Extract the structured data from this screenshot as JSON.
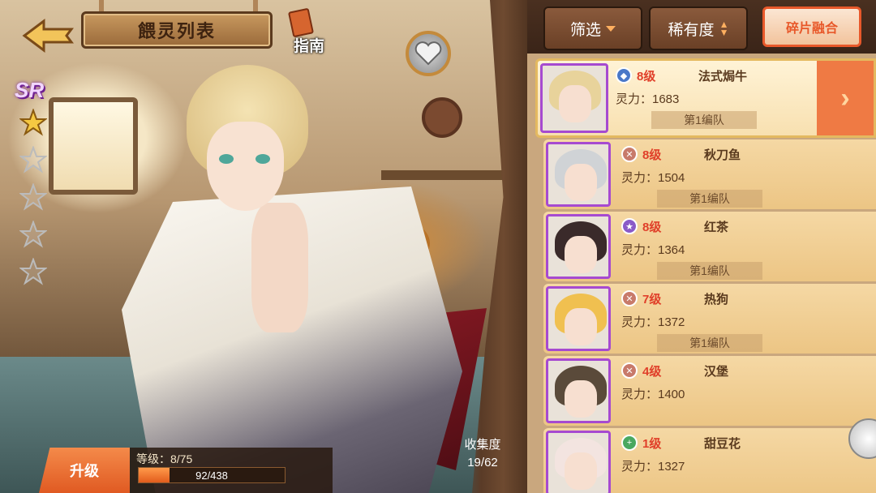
{
  "header": {
    "title": "餵灵列表",
    "guide_label": "指南"
  },
  "character": {
    "rarity": "SR",
    "stars_filled": 1,
    "stars_total": 5,
    "level_text": "等级：8/75",
    "xp_current": 92,
    "xp_max": 438,
    "xp_text": "92/438",
    "upgrade_label": "升级"
  },
  "collection": {
    "label": "收集度",
    "value": "19/62"
  },
  "toolbar": {
    "filter_label": "筛选",
    "rarity_label": "稀有度",
    "fuse_label": "碎片融合"
  },
  "list": [
    {
      "level": "8级",
      "name": "法式焗牛",
      "power": "灵力：1683",
      "team": "第1编队",
      "badge_color": "#4a78c8",
      "badge_icon": "shield-icon",
      "hair": "#e8d39b",
      "selected": true
    },
    {
      "level": "8级",
      "name": "秋刀鱼",
      "power": "灵力：1504",
      "team": "第1编队",
      "badge_color": "#c87a6a",
      "badge_icon": "swords-icon",
      "hair": "#d0d3d6",
      "selected": false
    },
    {
      "level": "8级",
      "name": "红茶",
      "power": "灵力：1364",
      "team": "第1编队",
      "badge_color": "#8a5ac8",
      "badge_icon": "star-icon",
      "hair": "#3a2a2a",
      "selected": false
    },
    {
      "level": "7级",
      "name": "热狗",
      "power": "灵力：1372",
      "team": "第1编队",
      "badge_color": "#c87a6a",
      "badge_icon": "swords-icon",
      "hair": "#f0c050",
      "selected": false
    },
    {
      "level": "4级",
      "name": "汉堡",
      "power": "灵力：1400",
      "team": "",
      "badge_color": "#c87a6a",
      "badge_icon": "swords-icon",
      "hair": "#5a4a3a",
      "selected": false
    },
    {
      "level": "1级",
      "name": "甜豆花",
      "power": "灵力：1327",
      "team": "",
      "badge_color": "#4aa860",
      "badge_icon": "plus-icon",
      "hair": "#f3e4e0",
      "selected": false
    }
  ]
}
